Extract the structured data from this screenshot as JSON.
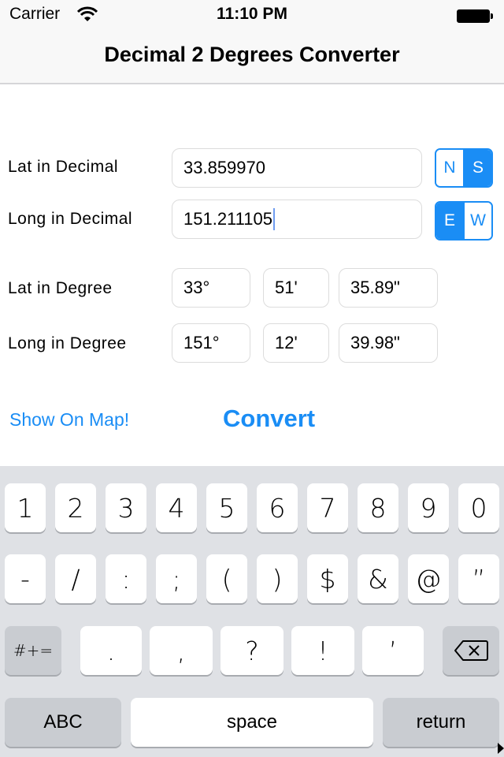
{
  "status_bar": {
    "carrier": "Carrier",
    "wifi_icon": "wifi-icon",
    "time": "11:10 PM",
    "battery_icon": "battery-full-icon"
  },
  "nav": {
    "title": "Decimal 2 Degrees Converter"
  },
  "form": {
    "lat_decimal": {
      "label": "Lat in Decimal",
      "value": "33.859970",
      "hemisphere_options": [
        "N",
        "S"
      ],
      "hemisphere_selected": "S"
    },
    "long_decimal": {
      "label": "Long in Decimal",
      "value": "151.211105",
      "focused": true,
      "hemisphere_options": [
        "E",
        "W"
      ],
      "hemisphere_selected": "E"
    },
    "lat_degree": {
      "label": "Lat in Degree",
      "degrees": "33°",
      "minutes": "51'",
      "seconds": "35.89\""
    },
    "long_degree": {
      "label": "Long in Degree",
      "degrees": "151°",
      "minutes": "12'",
      "seconds": "39.98\""
    }
  },
  "actions": {
    "show_on_map": "Show On Map!",
    "convert": "Convert"
  },
  "colors": {
    "accent": "#1a8df5",
    "keyboard_bg": "#dfe1e5",
    "key_dark": "#c9ccd1"
  },
  "keyboard": {
    "row1": [
      "1",
      "2",
      "3",
      "4",
      "5",
      "6",
      "7",
      "8",
      "9",
      "0"
    ],
    "row2": [
      "-",
      "/",
      ":",
      ";",
      "(",
      ")",
      "$",
      "&",
      "@",
      "”"
    ],
    "row3": {
      "symbols_toggle": "#+=",
      "keys": [
        ".",
        ",",
        "?",
        "!",
        "’"
      ],
      "backspace_icon": "backspace-icon"
    },
    "row4": {
      "abc": "ABC",
      "space": "space",
      "return": "return"
    }
  }
}
